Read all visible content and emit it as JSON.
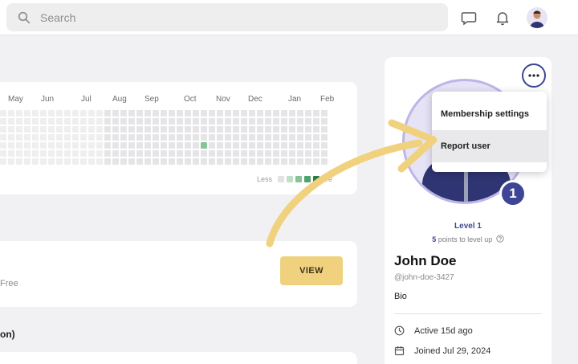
{
  "search": {
    "placeholder": "Search"
  },
  "activity": {
    "months": [
      "May",
      "Jun",
      "Jul",
      "Aug",
      "Sep",
      "Oct",
      "Nov",
      "Dec",
      "Jan",
      "Feb"
    ],
    "legend_less": "Less",
    "legend_more": "ore"
  },
  "membership": {
    "price_text": "Free",
    "view_label": "VIEW"
  },
  "section_label": "on)",
  "profile": {
    "level_badge": "1",
    "level_label": "Level 1",
    "points_num": "5",
    "points_text": " points to level up",
    "name": "John Doe",
    "handle": "@john-doe-3427",
    "bio": "Bio",
    "active": "Active 15d ago",
    "joined": "Joined Jul 29, 2024"
  },
  "menu": {
    "items": [
      "Membership settings",
      "Report user"
    ],
    "highlighted_index": 1
  },
  "colors": {
    "accent": "#3d4696",
    "view_button": "#f0d27e",
    "arrow": "#f0d27e",
    "activity_on": "#86c49a"
  },
  "icons": [
    "search-icon",
    "chat-icon",
    "bell-icon",
    "more-icon",
    "info-icon",
    "clock-icon",
    "calendar-icon",
    "arrow-annotation"
  ]
}
